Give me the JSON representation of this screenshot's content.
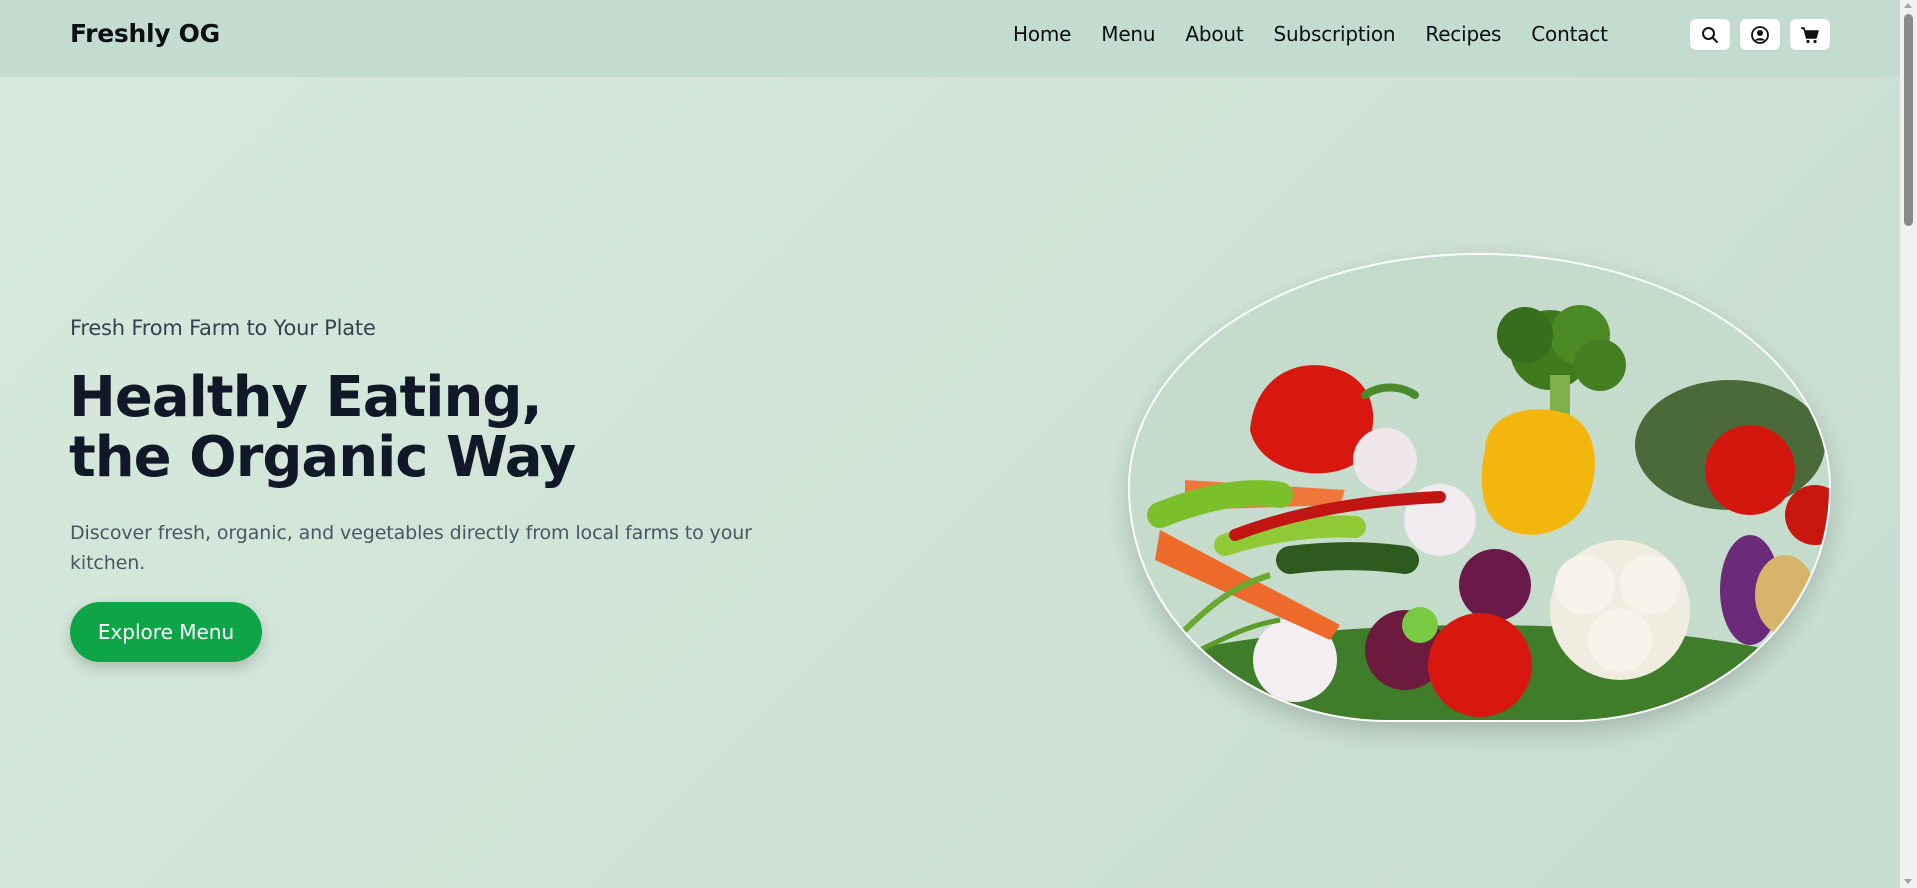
{
  "header": {
    "brand": "Freshly OG",
    "nav": [
      "Home",
      "Menu",
      "About",
      "Subscription",
      "Recipes",
      "Contact"
    ],
    "icons": [
      "search-icon",
      "user-icon",
      "cart-icon"
    ]
  },
  "hero": {
    "kicker": "Fresh From Farm to Your Plate",
    "headline_line1": "Healthy Eating,",
    "headline_line2": "the Organic Way",
    "description": "Discover fresh, organic, and vegetables directly from local farms to your kitchen.",
    "cta_label": "Explore Menu",
    "image": "fresh-vegetables-illustration"
  },
  "colors": {
    "background": "#d2e6d9",
    "header": "#c4dccf",
    "accent": "#0ea548",
    "text_dark": "#111827",
    "text_muted": "#4b5563"
  }
}
